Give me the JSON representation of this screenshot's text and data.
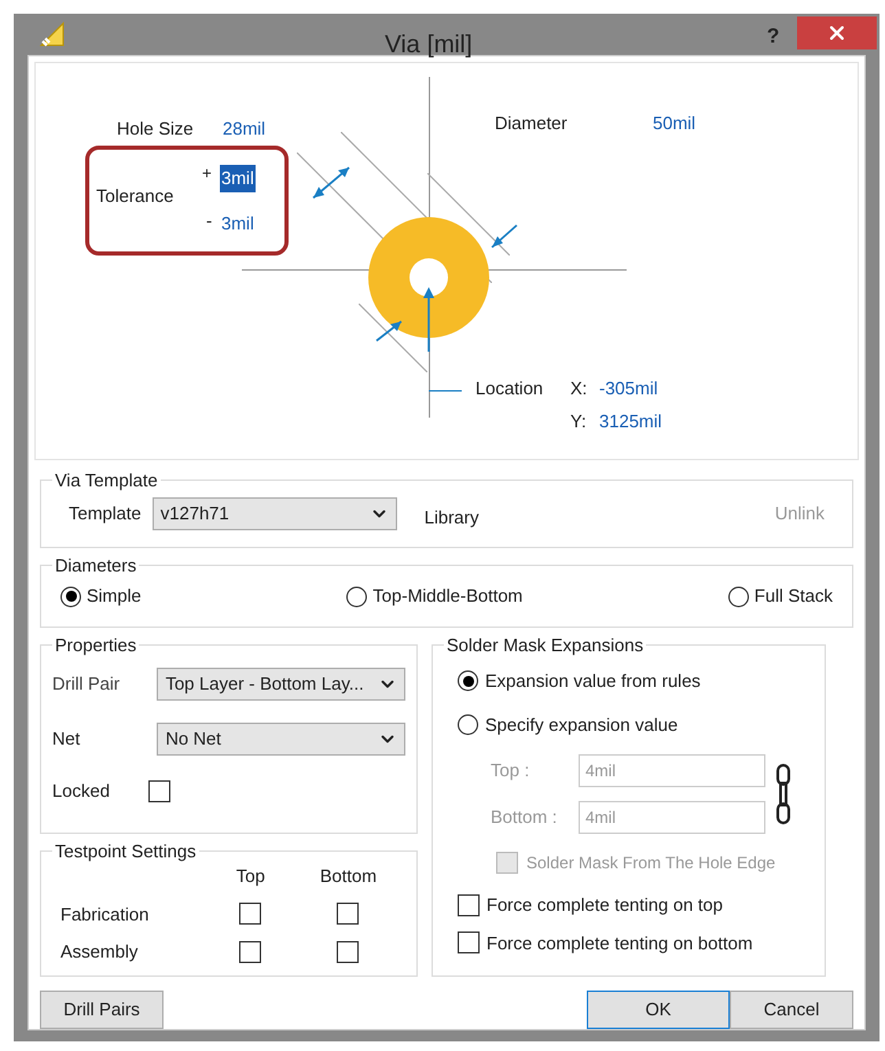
{
  "window": {
    "title": "Via [mil]",
    "help": "?"
  },
  "diagram": {
    "hole_size": {
      "label": "Hole Size",
      "value": "28mil"
    },
    "tolerance": {
      "label": "Tolerance",
      "plus_sign": "+",
      "plus_value": "3mil",
      "plus_selected": true,
      "minus_sign": "-",
      "minus_value": "3mil"
    },
    "diameter": {
      "label": "Diameter",
      "value": "50mil"
    },
    "location": {
      "label": "Location",
      "x_label": "X:",
      "x_value": "-305mil",
      "y_label": "Y:",
      "y_value": "3125mil"
    }
  },
  "via_template": {
    "title": "Via Template",
    "template_label": "Template",
    "template_value": "v127h71",
    "library_label": "Library",
    "unlink": {
      "label": "Unlink",
      "disabled": true
    }
  },
  "diameters": {
    "title": "Diameters",
    "options": [
      {
        "label": "Simple",
        "selected": true
      },
      {
        "label": "Top-Middle-Bottom",
        "selected": false
      },
      {
        "label": "Full Stack",
        "selected": false
      }
    ]
  },
  "properties": {
    "title": "Properties",
    "drill_pair": {
      "label": "Drill Pair",
      "value": "Top Layer - Bottom Lay..."
    },
    "net": {
      "label": "Net",
      "value": "No Net"
    },
    "locked": {
      "label": "Locked",
      "checked": false
    }
  },
  "testpoint": {
    "title": "Testpoint Settings",
    "columns": [
      "Top",
      "Bottom"
    ],
    "rows": [
      {
        "label": "Fabrication",
        "checks": [
          false,
          false
        ]
      },
      {
        "label": "Assembly",
        "checks": [
          false,
          false
        ]
      }
    ]
  },
  "solder_mask": {
    "title": "Solder Mask Expansions",
    "options": [
      {
        "label": "Expansion value from rules",
        "selected": true
      },
      {
        "label": "Specify expansion value",
        "selected": false
      }
    ],
    "fields": [
      {
        "label": "Top :",
        "value": "4mil",
        "disabled": true
      },
      {
        "label": "Bottom :",
        "value": "4mil",
        "disabled": true
      }
    ],
    "hole_edge": {
      "label": "Solder Mask From The Hole Edge",
      "checked": false,
      "disabled": true
    },
    "tenting": [
      {
        "label": "Force complete tenting on top",
        "checked": false
      },
      {
        "label": "Force complete tenting on bottom",
        "checked": false
      }
    ]
  },
  "buttons": [
    {
      "label": "Drill Pairs",
      "default": false
    },
    {
      "label": "OK",
      "default": true
    },
    {
      "label": "Cancel",
      "default": false
    }
  ]
}
